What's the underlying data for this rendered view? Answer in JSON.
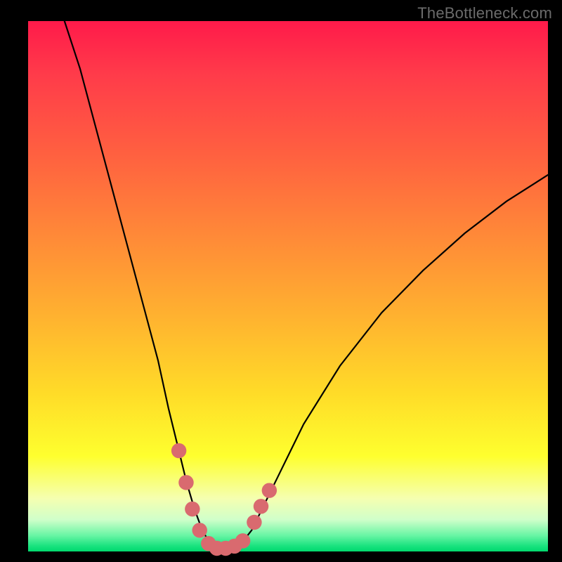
{
  "watermark": "TheBottleneck.com",
  "chart_data": {
    "type": "line",
    "title": "",
    "xlabel": "",
    "ylabel": "",
    "xlim": [
      0,
      100
    ],
    "ylim": [
      0,
      100
    ],
    "grid": false,
    "legend": false,
    "series": [
      {
        "name": "bottleneck-curve",
        "color": "#000000",
        "x": [
          7,
          10,
          13,
          16,
          19,
          22,
          25,
          27,
          29,
          30.5,
          32,
          33.5,
          35,
          37,
          39,
          41,
          43,
          45,
          48,
          53,
          60,
          68,
          76,
          84,
          92,
          100
        ],
        "y": [
          100,
          91,
          80,
          69,
          58,
          47,
          36,
          27,
          19,
          13,
          8,
          4,
          1.5,
          0.5,
          0.5,
          1.5,
          4,
          8,
          14,
          24,
          35,
          45,
          53,
          60,
          66,
          71
        ]
      }
    ],
    "markers": {
      "name": "highlight-dots",
      "color": "#d96a6f",
      "radius_pct": 1.45,
      "points": [
        {
          "x": 29.0,
          "y": 19.0
        },
        {
          "x": 30.4,
          "y": 13.0
        },
        {
          "x": 31.6,
          "y": 8.0
        },
        {
          "x": 33.0,
          "y": 4.0
        },
        {
          "x": 34.7,
          "y": 1.5
        },
        {
          "x": 36.3,
          "y": 0.6
        },
        {
          "x": 38.0,
          "y": 0.6
        },
        {
          "x": 39.7,
          "y": 1.0
        },
        {
          "x": 41.3,
          "y": 2.0
        },
        {
          "x": 43.5,
          "y": 5.5
        },
        {
          "x": 44.8,
          "y": 8.5
        },
        {
          "x": 46.4,
          "y": 11.5
        }
      ]
    }
  }
}
